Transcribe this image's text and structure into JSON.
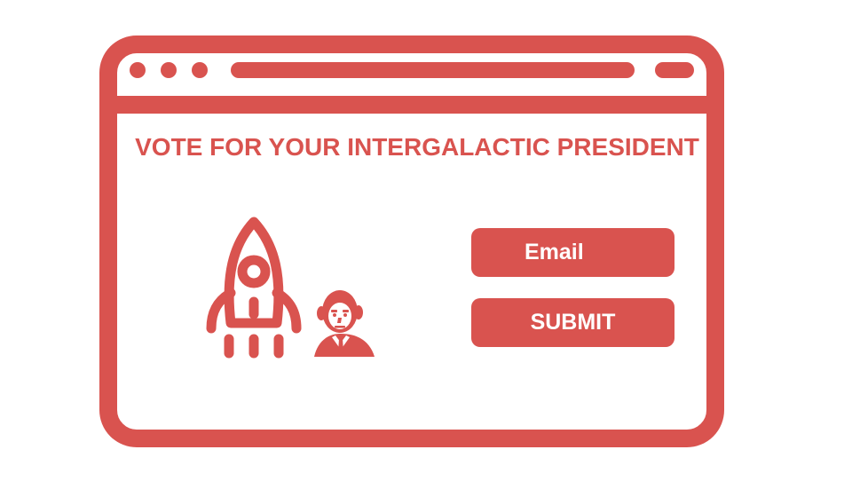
{
  "window": {
    "title_dots": [
      "dot-1",
      "dot-2",
      "dot-3"
    ]
  },
  "page": {
    "title": "VOTE FOR YOUR INTERGALACTIC PRESIDENT"
  },
  "form": {
    "email_label": "Email",
    "submit_label": "SUBMIT"
  },
  "icons": {
    "rocket": "rocket-icon",
    "portrait": "president-portrait"
  },
  "colors": {
    "accent": "#d9534f",
    "background": "#ffffff",
    "button_text": "#ffffff"
  }
}
